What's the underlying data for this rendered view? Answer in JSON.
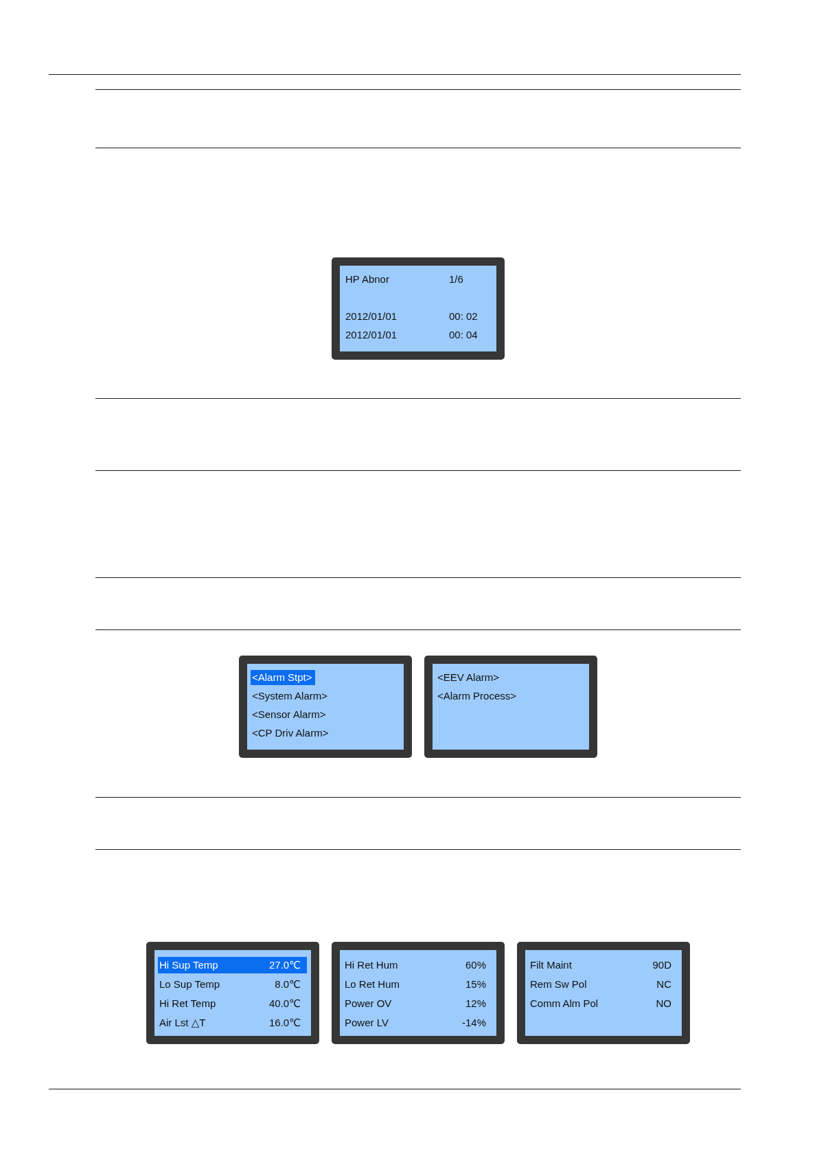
{
  "figures": [
    {
      "screens": [
        {
          "kind": "record",
          "title": "HP Abnor",
          "page": "1/6",
          "entries": [
            {
              "date": "2012/01/01",
              "time": "00: 02"
            },
            {
              "date": "2012/01/01",
              "time": "00: 04"
            }
          ]
        }
      ]
    },
    {
      "screens": [
        {
          "kind": "menu",
          "items": [
            {
              "label": "<Alarm Stpt>",
              "selected": true
            },
            {
              "label": "<System Alarm>",
              "selected": false
            },
            {
              "label": "<Sensor Alarm>",
              "selected": false
            },
            {
              "label": "<CP Driv Alarm>",
              "selected": false
            }
          ]
        },
        {
          "kind": "menu",
          "items": [
            {
              "label": "<EEV Alarm>",
              "selected": false
            },
            {
              "label": "<Alarm Process>",
              "selected": false
            }
          ]
        }
      ]
    },
    {
      "screens": [
        {
          "kind": "params",
          "items": [
            {
              "label": "Hi Sup Temp",
              "value": "27.0℃",
              "selected": true
            },
            {
              "label": "Lo Sup Temp",
              "value": "8.0℃",
              "selected": false
            },
            {
              "label": "Hi Ret Temp",
              "value": "40.0℃",
              "selected": false
            },
            {
              "label": "Air Lst △T",
              "value": "16.0℃",
              "selected": false
            }
          ]
        },
        {
          "kind": "params",
          "items": [
            {
              "label": "Hi Ret Hum",
              "value": "60%",
              "selected": false
            },
            {
              "label": "Lo Ret Hum",
              "value": "15%",
              "selected": false
            },
            {
              "label": "Power OV",
              "value": "12%",
              "selected": false
            },
            {
              "label": "Power LV",
              "value": "-14%",
              "selected": false
            }
          ]
        },
        {
          "kind": "params",
          "items": [
            {
              "label": "Filt Maint",
              "value": "90D",
              "selected": false
            },
            {
              "label": "Rem Sw Pol",
              "value": "NC",
              "selected": false
            },
            {
              "label": "Comm Alm Pol",
              "value": "NO",
              "selected": false
            }
          ]
        }
      ]
    }
  ]
}
